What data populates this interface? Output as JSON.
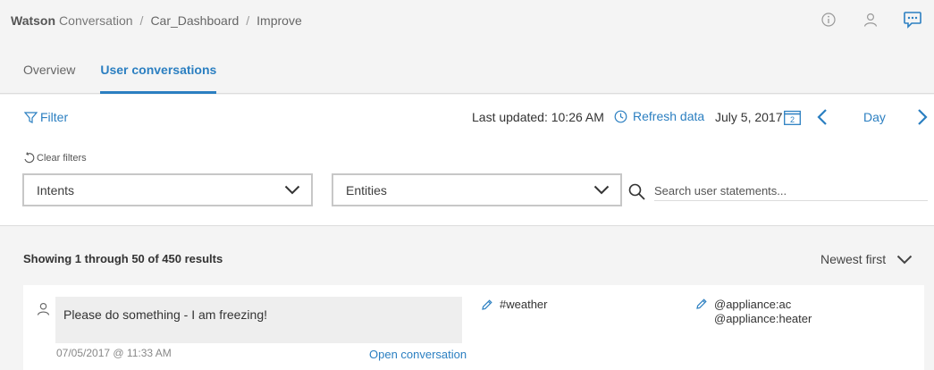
{
  "breadcrumb": {
    "brand_strong": "Watson",
    "brand_light": "Conversation",
    "workspace": "Car_Dashboard",
    "page": "Improve",
    "separator": "/"
  },
  "header_icons": [
    "info-icon",
    "user-icon",
    "chat-icon"
  ],
  "tabs": [
    {
      "label": "Overview",
      "active": false
    },
    {
      "label": "User conversations",
      "active": true
    }
  ],
  "toolbar": {
    "filter_label": "Filter",
    "last_updated": "Last updated: 10:26 AM",
    "refresh_label": "Refresh data",
    "date": "July 5, 2017",
    "calendar_day": "2",
    "period": "Day",
    "clear_filters": "Clear filters"
  },
  "filters": {
    "intents_label": "Intents",
    "entities_label": "Entities",
    "search_placeholder": "Search user statements...",
    "search_value": ""
  },
  "results": {
    "summary": "Showing 1 through 50 of 450 results",
    "sort_label": "Newest first"
  },
  "conversations": [
    {
      "message": "Please do something - I am freezing!",
      "timestamp": "07/05/2017 @ 11:33 AM",
      "open_label": "Open conversation",
      "intent": "#weather",
      "entities": [
        "@appliance:ac",
        "@appliance:heater"
      ]
    }
  ],
  "colors": {
    "accent": "#2b7fc1",
    "background": "#f4f4f4",
    "panel": "#ffffff",
    "bubble": "#eeeeee"
  }
}
